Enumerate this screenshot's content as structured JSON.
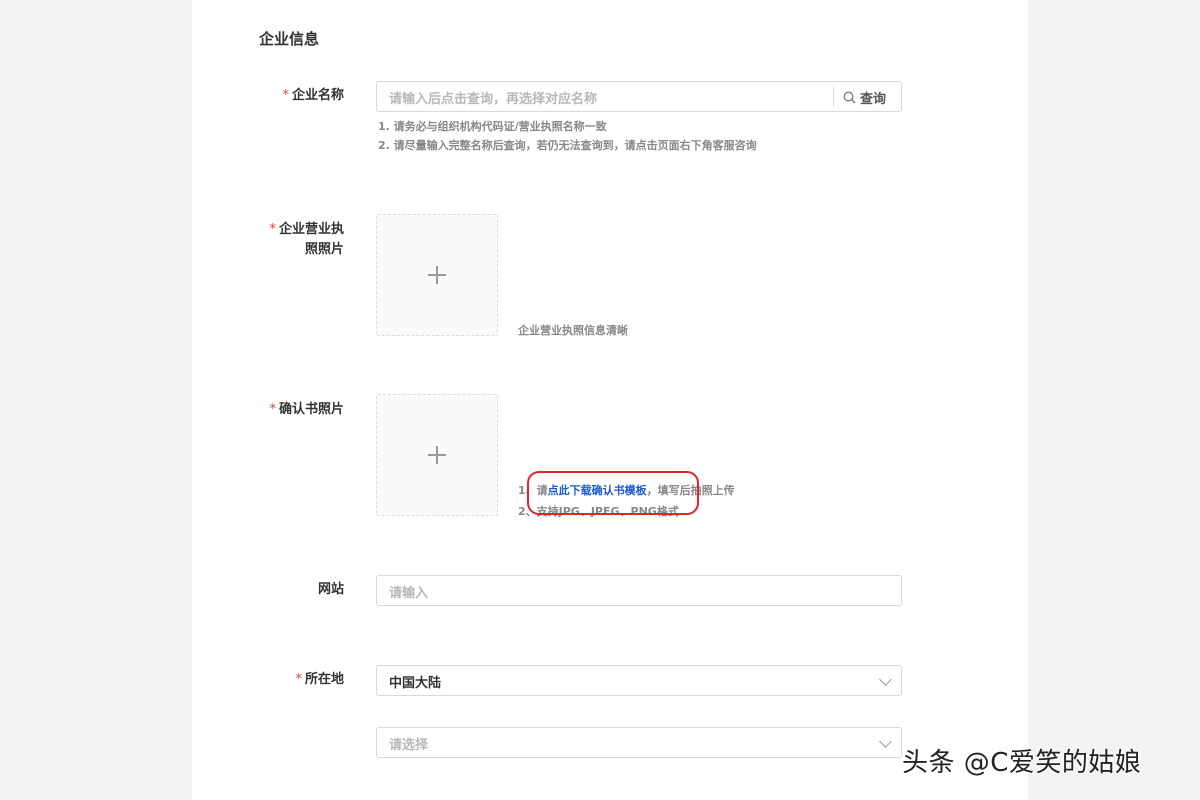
{
  "section": {
    "title": "企业信息"
  },
  "required_mark": "*",
  "company_name": {
    "label": "企业名称",
    "placeholder": "请输入后点击查询，再选择对应名称",
    "query_label": "查询",
    "hints": [
      "1. 请务必与组织机构代码证/营业执照名称一致",
      "2. 请尽量输入完整名称后查询，若仍无法查询到，请点击页面右下角客服咨询"
    ]
  },
  "license_photo": {
    "label_line1": "企业营业执",
    "label_line2": "照照片",
    "hint": "企业营业执照信息清晰"
  },
  "confirm_photo": {
    "label": "确认书照片",
    "hint1_prefix": "1、请",
    "hint1_link": "点此下载确认书模板",
    "hint1_suffix": "，填写后拍照上传",
    "hint2": "2、支持JPG、JPEG、PNG格式"
  },
  "website": {
    "label": "网站",
    "placeholder": "请输入"
  },
  "location": {
    "label": "所在地",
    "selected": "中国大陆",
    "second_placeholder": "请选择"
  },
  "watermark": "头条 @C爱笑的姑娘"
}
